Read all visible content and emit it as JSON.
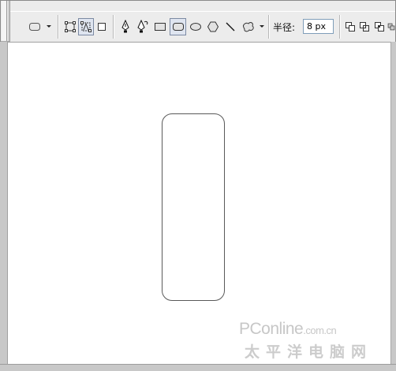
{
  "toolbar": {
    "radius_label": "半径:",
    "radius_value": "8 px",
    "tools": [
      "preset-rounded-rect-icon",
      "dropdown-arrow-icon",
      "shape-layers-icon",
      "paths-icon",
      "fill-pixels-icon",
      "pen-icon",
      "freeform-pen-icon",
      "rectangle-icon",
      "rounded-rectangle-icon",
      "ellipse-icon",
      "polygon-icon",
      "line-icon",
      "custom-shape-icon",
      "add-to-shape-area-icon",
      "subtract-from-shape-area-icon",
      "intersect-shape-areas-icon",
      "exclude-overlapping-icon"
    ]
  },
  "watermark": {
    "brand": "PConline",
    "suffix": ".com.cn",
    "chinese": "太平洋电脑网"
  }
}
